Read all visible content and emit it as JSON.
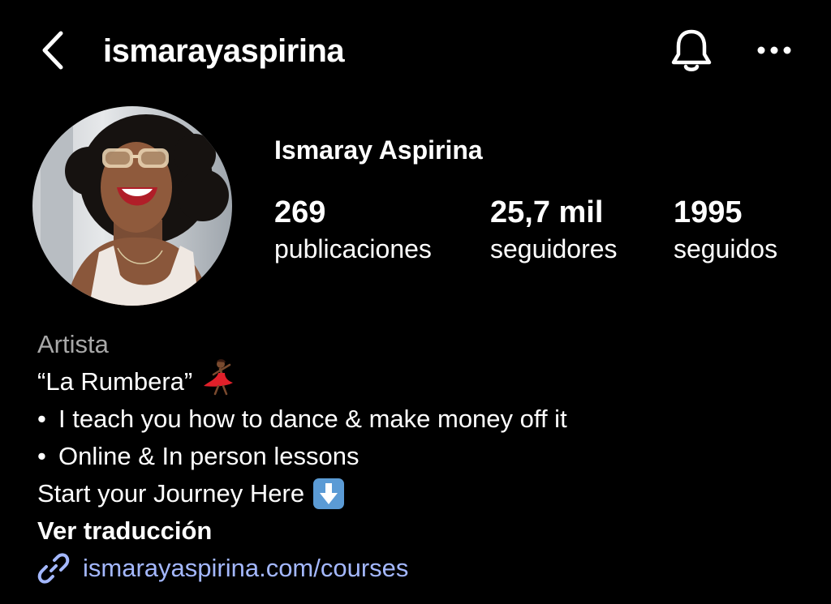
{
  "header": {
    "username": "ismarayaspirina",
    "back_icon": "chevron-left-icon",
    "bell_icon": "bell-icon",
    "more_icon": "more-horizontal-icon"
  },
  "profile": {
    "display_name": "Ismaray Aspirina",
    "avatar": "profile-photo"
  },
  "stats": {
    "posts": {
      "value": "269",
      "label": "publicaciones"
    },
    "followers": {
      "value": "25,7 mil",
      "label": "seguidores"
    },
    "following": {
      "value": "1995",
      "label": "seguidos"
    }
  },
  "bio": {
    "category": "Artista",
    "line1": "“La Rumbera”",
    "line2_bullet": "•",
    "line2": "I teach you how to dance & make money off it",
    "line3_bullet": "•",
    "line3": "Online & In person lessons",
    "line4": "Start your Journey Here",
    "translate": "Ver traducción",
    "link": "ismarayaspirina.com/courses"
  },
  "colors": {
    "background": "#000000",
    "text": "#ffffff",
    "category": "#a8a8a8",
    "link": "#a4b8ff"
  }
}
